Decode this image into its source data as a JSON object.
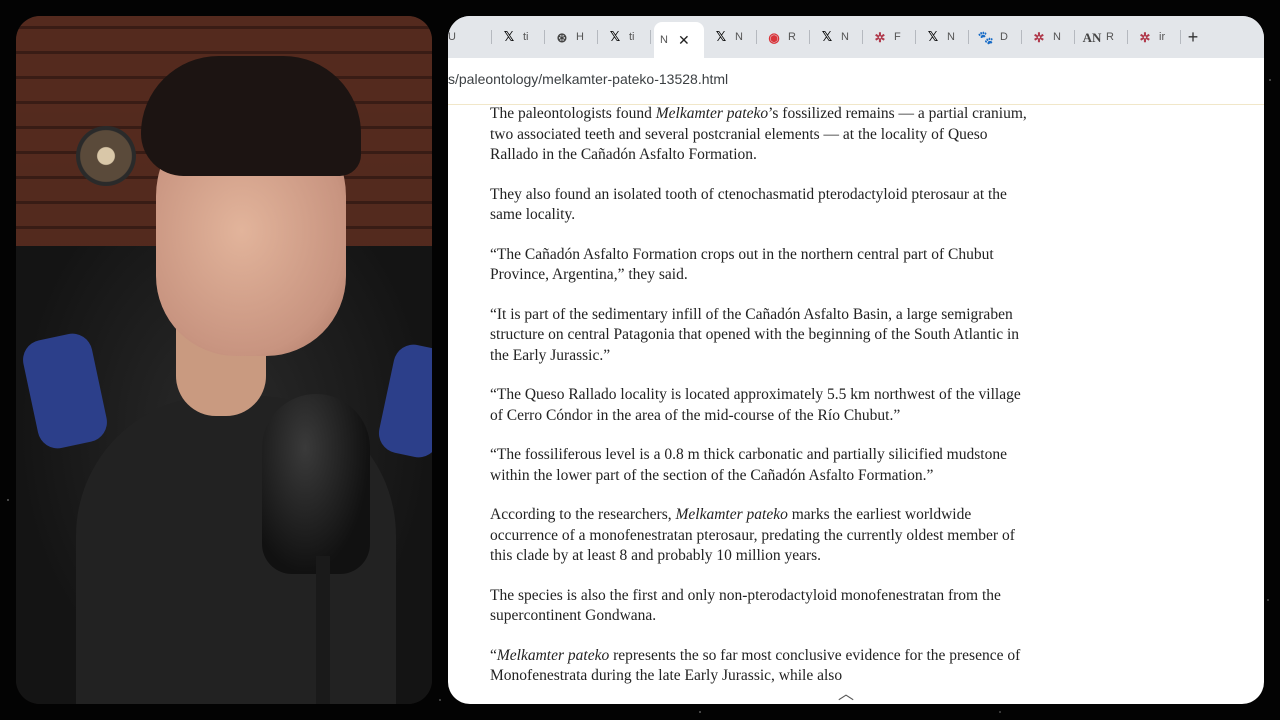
{
  "browser": {
    "tabs": [
      {
        "icon": "star-favicon-icon",
        "glyph": "",
        "label": "U",
        "active": false
      },
      {
        "icon": "x-logo-icon",
        "glyph": "𝕏",
        "label": "ti",
        "active": false
      },
      {
        "icon": "openai-logo-icon",
        "glyph": "⊛",
        "label": "H",
        "active": false
      },
      {
        "icon": "x-logo-icon",
        "glyph": "𝕏",
        "label": "ti",
        "active": false
      },
      {
        "icon": "none",
        "glyph": "",
        "label": "N",
        "active": true
      },
      {
        "icon": "x-logo-icon",
        "glyph": "𝕏",
        "label": "N",
        "active": false
      },
      {
        "icon": "red-circle-icon",
        "glyph": "◉",
        "label": "R",
        "active": false
      },
      {
        "icon": "x-logo-icon",
        "glyph": "𝕏",
        "label": "N",
        "active": false
      },
      {
        "icon": "sci-news-star-icon",
        "glyph": "✲",
        "label": "F",
        "active": false
      },
      {
        "icon": "x-logo-icon",
        "glyph": "𝕏",
        "label": "N",
        "active": false
      },
      {
        "icon": "paw-icon",
        "glyph": "🐾",
        "label": "D",
        "active": false
      },
      {
        "icon": "sci-news-star-icon",
        "glyph": "✲",
        "label": "N",
        "active": false
      },
      {
        "icon": "an-logo-icon",
        "glyph": "AN",
        "label": "R",
        "active": false
      },
      {
        "icon": "sci-news-star-icon",
        "glyph": "✲",
        "label": "ir",
        "active": false
      }
    ],
    "close_glyph": "✕",
    "new_tab_glyph": "+",
    "url": "s/paleontology/melkamter-pateko-13528.html"
  },
  "article": {
    "paragraphs": [
      [
        {
          "t": "The paleontologists found "
        },
        {
          "t": "Melkamter pateko",
          "i": true
        },
        {
          "t": "’s fossilized remains — a partial cranium, two associated teeth and several postcranial elements — at the locality of Queso Rallado in the Cañadón Asfalto Formation."
        }
      ],
      [
        {
          "t": "They also found an isolated tooth of ctenochasmatid pterodactyloid pterosaur at the same locality."
        }
      ],
      [
        {
          "t": "“The Cañadón Asfalto Formation crops out in the northern central part of Chubut Province, Argentina,” they said."
        }
      ],
      [
        {
          "t": "“It is part of the sedimentary infill of the Cañadón Asfalto Basin, a large semigraben structure on central Patagonia that opened with the beginning of the South Atlantic in the Early Jurassic.”"
        }
      ],
      [
        {
          "t": "“The Queso Rallado locality is located approximately 5.5 km northwest of the village of Cerro Cóndor in the area of the mid-course of the Río Chubut.”"
        }
      ],
      [
        {
          "t": "“The fossiliferous level is a 0.8 m thick carbonatic and partially silicified mudstone within the lower part of the section of the Cañadón Asfalto Formation.”"
        }
      ],
      [
        {
          "t": "According to the researchers, "
        },
        {
          "t": "Melkamter pateko",
          "i": true
        },
        {
          "t": " marks the earliest worldwide occurrence of a monofenestratan pterosaur, predating the currently oldest member of this clade by at least 8 and probably 10 million years."
        }
      ],
      [
        {
          "t": "The species is also the first and only non-pterodactyloid monofenestratan from the supercontinent Gondwana."
        }
      ],
      [
        {
          "t": "“"
        },
        {
          "t": "Melkamter pateko",
          "i": true
        },
        {
          "t": " represents the so far most conclusive evidence for the presence of Monofenestrata during the late Early Jurassic, while also"
        }
      ]
    ]
  },
  "scroll_up_glyph": "︿"
}
